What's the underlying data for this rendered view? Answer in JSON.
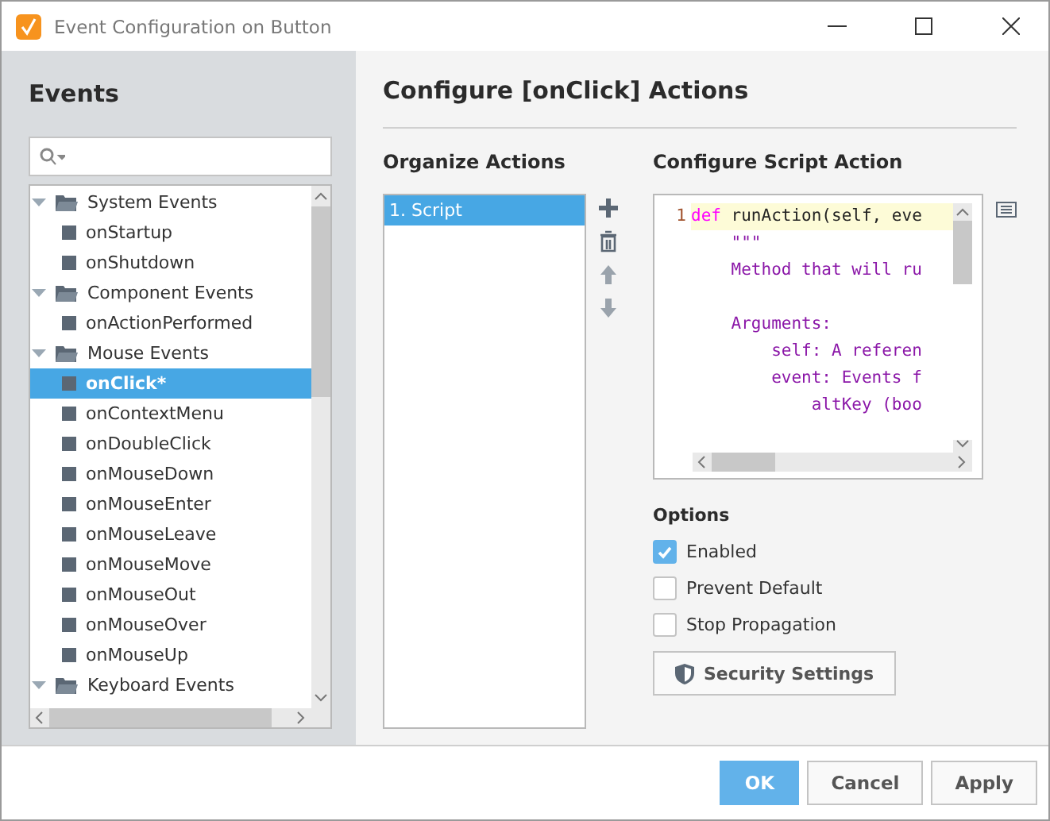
{
  "window": {
    "title": "Event Configuration on Button"
  },
  "events": {
    "heading": "Events",
    "tree": [
      {
        "label": "System Events",
        "expanded": true,
        "children": [
          {
            "label": "onStartup",
            "selected": false
          },
          {
            "label": "onShutdown",
            "selected": false
          }
        ]
      },
      {
        "label": "Component Events",
        "expanded": true,
        "children": [
          {
            "label": "onActionPerformed",
            "selected": false
          }
        ]
      },
      {
        "label": "Mouse Events",
        "expanded": true,
        "children": [
          {
            "label": "onClick*",
            "selected": true
          },
          {
            "label": "onContextMenu",
            "selected": false
          },
          {
            "label": "onDoubleClick",
            "selected": false
          },
          {
            "label": "onMouseDown",
            "selected": false
          },
          {
            "label": "onMouseEnter",
            "selected": false
          },
          {
            "label": "onMouseLeave",
            "selected": false
          },
          {
            "label": "onMouseMove",
            "selected": false
          },
          {
            "label": "onMouseOut",
            "selected": false
          },
          {
            "label": "onMouseOver",
            "selected": false
          },
          {
            "label": "onMouseUp",
            "selected": false
          }
        ]
      },
      {
        "label": "Keyboard Events",
        "expanded": true
      }
    ]
  },
  "configure": {
    "title": "Configure [onClick] Actions",
    "organize": {
      "heading": "Organize Actions",
      "actions": [
        {
          "label": "1. Script",
          "selected": true
        }
      ]
    },
    "script": {
      "heading": "Configure Script Action",
      "line_number": "1",
      "lines": [
        {
          "kind": "def",
          "keyword": "def",
          "text": " runAction(self, eve"
        },
        {
          "kind": "doc",
          "text": "    \"\"\""
        },
        {
          "kind": "doc",
          "text": "    Method that will ru"
        },
        {
          "kind": "blank"
        },
        {
          "kind": "doc",
          "text": "    Arguments:"
        },
        {
          "kind": "doc",
          "text": "        self: A referen"
        },
        {
          "kind": "doc",
          "text": "        event: Events f"
        },
        {
          "kind": "doc",
          "text": "            altKey (boo"
        }
      ]
    },
    "options": {
      "heading": "Options",
      "items": [
        {
          "label": "Enabled",
          "checked": true
        },
        {
          "label": "Prevent Default",
          "checked": false
        },
        {
          "label": "Stop Propagation",
          "checked": false
        }
      ]
    },
    "security_button": "Security Settings"
  },
  "buttons": [
    {
      "label": "OK",
      "primary": true
    },
    {
      "label": "Cancel",
      "primary": false
    },
    {
      "label": "Apply",
      "primary": false
    }
  ]
}
